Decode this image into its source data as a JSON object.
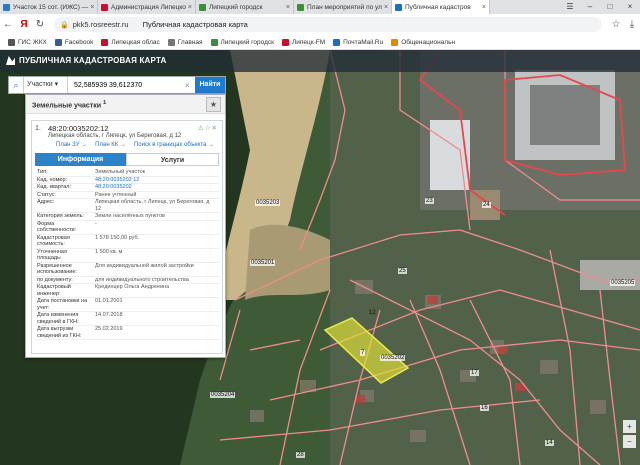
{
  "browser": {
    "tabs": [
      {
        "title": "Участок 15 сот. (ИЖС) — ",
        "color": "#2a78c8",
        "active": false
      },
      {
        "title": "Администрация Липецко",
        "color": "#c8102e",
        "active": false
      },
      {
        "title": "Липецкий городск",
        "color": "#3c8d3c",
        "active": false
      },
      {
        "title": "План мероприятий по ул",
        "color": "#3c8d3c",
        "active": false
      },
      {
        "title": "Публичная кадастров",
        "color": "#1a6fc2",
        "active": true
      }
    ],
    "url_domain": "pkk5.rosreestr.ru",
    "page_title": "Публичная кадастровая карта",
    "bookmarks": [
      {
        "label": "ГИС ЖКХ",
        "color": "#555"
      },
      {
        "label": "Facebook",
        "color": "#3b5998"
      },
      {
        "label": "Липецкая облас",
        "color": "#c8102e"
      },
      {
        "label": "Главная",
        "color": "#777"
      },
      {
        "label": "Липецкий городск",
        "color": "#3c8d3c"
      },
      {
        "label": "Липецк-FM",
        "color": "#c8102e"
      },
      {
        "label": "ПочтаMail.Ru",
        "color": "#1a6fc2"
      },
      {
        "label": "Общенациональн",
        "color": "#e08a00"
      }
    ]
  },
  "map_header": {
    "title": "ПУБЛИЧНАЯ КАДАСТРОВАЯ КАРТА"
  },
  "search": {
    "type": "Участки",
    "value": "52,585939 39,612370",
    "button": "Найти"
  },
  "panel": {
    "title": "Земельные участки",
    "count": "1",
    "item_number": "1.",
    "cadastral_id": "48:20:0035202:12",
    "address": "Липецкая область, г Липецк, ул Береговая, д 12",
    "links": [
      "План ЗУ →",
      "План КК →",
      "Поиск в границах объекта →"
    ],
    "tab_info": "Информация",
    "tab_services": "Услуги",
    "rows": [
      {
        "k": "Тип:",
        "v": "Земельный участок"
      },
      {
        "k": "Кад. номер:",
        "v": "48:20:0035202:12",
        "link": true
      },
      {
        "k": "Кад. квартал:",
        "v": "48:20:0035202",
        "link": true
      },
      {
        "k": "Статус:",
        "v": "Ранее учтенный"
      },
      {
        "k": "Адрес:",
        "v": "Липецкая область, г Липецк, ул Береговая, д 12"
      },
      {
        "k": "Категория земель:",
        "v": "Земли населённых пунктов"
      },
      {
        "k": "Форма собственности:",
        "v": "-"
      },
      {
        "k": "Кадастровая стоимость:",
        "v": "1 578 150,00 руб."
      },
      {
        "k": "Уточненная площадь:",
        "v": "1 500 кв. м"
      },
      {
        "k": "Разрешенное использование:",
        "v": "Для индивидуальной жилой застройки"
      },
      {
        "k": "по документу:",
        "v": "для индивидуального строительства"
      },
      {
        "k": "Кадастровый инженер:",
        "v": "Крединцер Ольга Андреевна"
      },
      {
        "k": "Дата постановки на учет:",
        "v": "01.01.2001"
      },
      {
        "k": "Дата изменения сведений в ГКН:",
        "v": "14.07.2018"
      },
      {
        "k": "Дата выгрузки сведений из ГКН:",
        "v": "25.02.2019"
      }
    ]
  },
  "map_labels": {
    "parcel": "12",
    "quarter_a": "0035202",
    "quarter_b": "0035204",
    "quarter_c": "0035203",
    "quarter_d": "0035201",
    "quarter_e": "0035205",
    "n24": "24",
    "n23": "23",
    "n16": "16",
    "n17": "17",
    "n14": "14",
    "n7": "7",
    "n28": "28",
    "n25": "25"
  }
}
